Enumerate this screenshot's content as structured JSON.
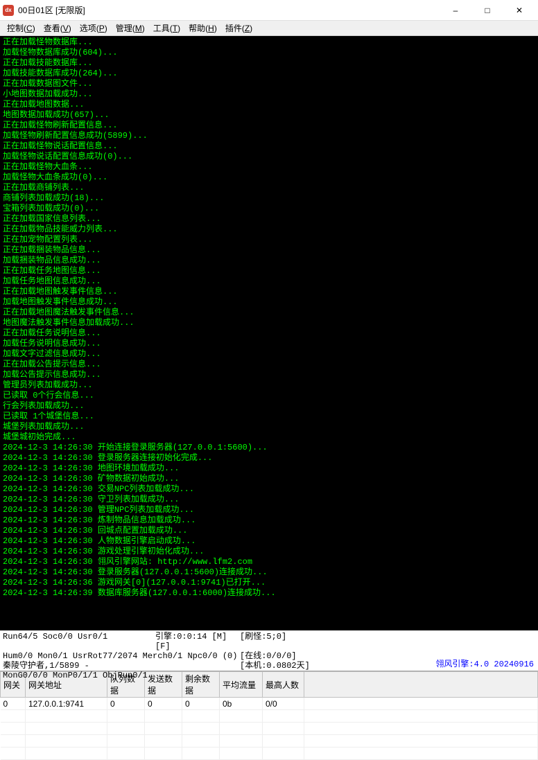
{
  "window": {
    "title": "00日01区 [无限版]"
  },
  "menu": {
    "items": [
      {
        "label": "控制",
        "key": "C"
      },
      {
        "label": "查看",
        "key": "V"
      },
      {
        "label": "选项",
        "key": "P"
      },
      {
        "label": "管理",
        "key": "M"
      },
      {
        "label": "工具",
        "key": "T"
      },
      {
        "label": "帮助",
        "key": "H"
      },
      {
        "label": "插件",
        "key": "Z"
      }
    ]
  },
  "console": {
    "lines": [
      "正在加载怪物数据库...",
      "加载怪物数据库成功(604)...",
      "正在加载技能数据库...",
      "加载技能数据库成功(264)...",
      "正在加载数据图文件...",
      "小地图数据加载成功...",
      "正在加载地图数据...",
      "地图数据加载成功(657)...",
      "正在加载怪物刷新配置信息...",
      "加载怪物刷新配置信息成功(5899)...",
      "正在加载怪物说话配置信息...",
      "加载怪物说话配置信息成功(0)...",
      "正在加载怪物大血条...",
      "加载怪物大血条成功(0)...",
      "正在加载商铺列表...",
      "商铺列表加载成功(18)...",
      "宝箱列表加载成功(0)...",
      "正在加载国家信息列表...",
      "正在加载物品技能威力列表...",
      "正在加宠物配置列表...",
      "正在加载捆装物品信息...",
      "加载捆装物品信息成功...",
      "正在加载任务地图信息...",
      "加载任务地图信息成功...",
      "正在加载地图触发事件信息...",
      "加载地图触发事件信息成功...",
      "正在加载地图魔法触发事件信息...",
      "地图魔法触发事件信息加载成功...",
      "正在加载任务说明信息...",
      "加载任务说明信息成功...",
      "加载文字过滤信息成功...",
      "正在加载公告提示信息...",
      "加载公告提示信息成功...",
      "管理员列表加载成功...",
      "已读取 0个行会信息...",
      "行会列表加载成功...",
      "已读取 1个城堡信息...",
      "城堡列表加载成功...",
      "城堡城初始完成...",
      "2024-12-3 14:26:30 开始连接登录服务器(127.0.0.1:5600)...",
      "2024-12-3 14:26:30 登录服务器连接初始化完成...",
      "2024-12-3 14:26:30 地图环境加载成功...",
      "2024-12-3 14:26:30 矿物数据初始成功...",
      "2024-12-3 14:26:30 交易NPC列表加载成功...",
      "2024-12-3 14:26:30 守卫列表加载成功...",
      "2024-12-3 14:26:30 管理NPC列表加载成功...",
      "2024-12-3 14:26:30 炼制物品信息加载成功...",
      "2024-12-3 14:26:30 回城点配置加载成功...",
      "2024-12-3 14:26:30 人物数据引擎启动成功...",
      "2024-12-3 14:26:30 游戏处理引擎初始化成功...",
      "2024-12-3 14:26:30 翎风引擎网站: http://www.lfm2.com",
      "2024-12-3 14:26:30 登录服务器(127.0.0.1:5600)连接成功...",
      "2024-12-3 14:26:36 游戏网关[0](127.0.0.1:9741)已打开...",
      "2024-12-3 14:26:39 数据库服务器(127.0.0.1:6000)连接成功..."
    ]
  },
  "status": {
    "r1c1": "Run64/5 Soc0/0 Usr0/1",
    "r1c2": "引擎:0:0:14 [M][F]",
    "r1c3": "[刷怪:5;0]",
    "r2c1": "Hum0/0 Mon0/1 UsrRot77/2074 Merch0/1 Npc0/0 (0)",
    "r2c3": "[在线:0/0/0]",
    "r3c1": "秦陵守护者,1/5899 -",
    "r3c3": "[本机:0.0802天]",
    "r4c1": "MonG0/0/0 MonP0/1/1 ObjRun0/1",
    "engine_version": "翎风引擎:4.0 20240916"
  },
  "table": {
    "headers": [
      "网关",
      "网关地址",
      "队列数据",
      "发送数据",
      "剩余数据",
      "平均流量",
      "最高人数"
    ],
    "rows": [
      {
        "gw": "0",
        "addr": "127.0.0.1:9741",
        "queue": "0",
        "send": "0",
        "remain": "0",
        "avg": "0b",
        "max": "0/0"
      }
    ]
  }
}
